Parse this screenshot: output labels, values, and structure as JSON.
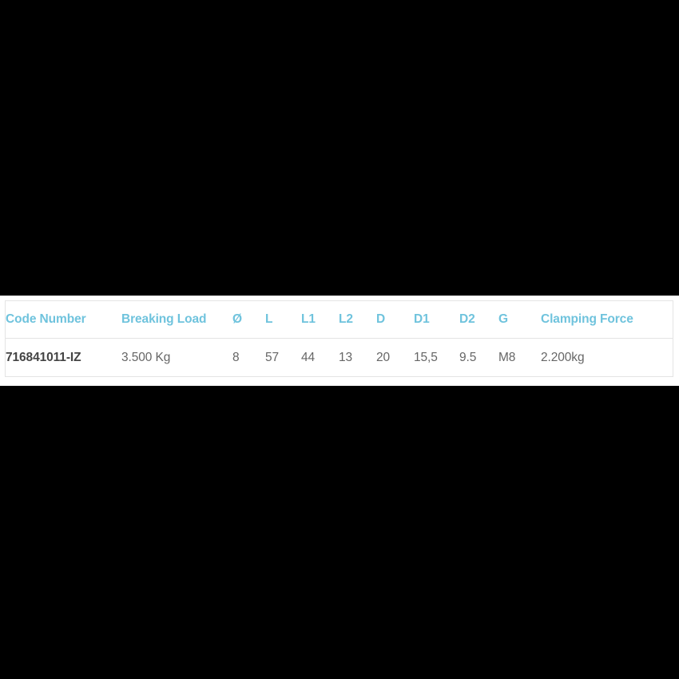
{
  "page": {
    "background_color": "#000000",
    "band_color": "#ffffff"
  },
  "table": {
    "name": "product-specification-table",
    "border_color": "#e4e4e4",
    "header_color": "#6fc3dd",
    "value_color": "#666666",
    "code_color": "#444444",
    "columns": [
      {
        "key": "code",
        "label": "Code Number"
      },
      {
        "key": "breaking_load",
        "label": "Breaking Load"
      },
      {
        "key": "diameter",
        "label": "Ø"
      },
      {
        "key": "l",
        "label": "L"
      },
      {
        "key": "l1",
        "label": "L1"
      },
      {
        "key": "l2",
        "label": "L2"
      },
      {
        "key": "d",
        "label": "D"
      },
      {
        "key": "d1",
        "label": "D1"
      },
      {
        "key": "d2",
        "label": "D2"
      },
      {
        "key": "g",
        "label": "G"
      },
      {
        "key": "clamping_force",
        "label": "Clamping Force"
      }
    ],
    "rows": [
      {
        "code": "716841011-IZ",
        "breaking_load": "3.500 Kg",
        "diameter": "8",
        "l": "57",
        "l1": "44",
        "l2": "13",
        "d": "20",
        "d1": "15,5",
        "d2": "9.5",
        "g": "M8",
        "clamping_force": "2.200kg"
      }
    ]
  }
}
